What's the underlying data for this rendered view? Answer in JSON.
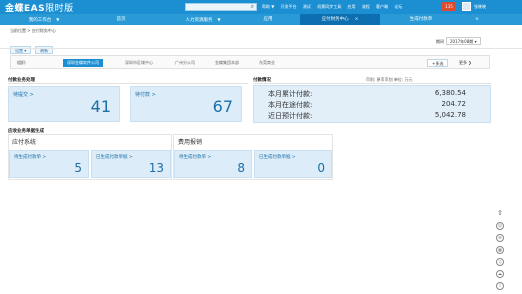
{
  "header": {
    "brand": "金蝶EAS",
    "brand_suffix": "限时版",
    "search_placeholder": "",
    "links": [
      "帮助 ▼",
      "开发平台",
      "测试",
      "机票同步工具",
      "应用",
      "流程",
      "客户端",
      "论坛"
    ],
    "badge": "135",
    "user": "张晓晓"
  },
  "nav": [
    {
      "label": "我的工作台",
      "dropdown": true
    },
    {
      "label": "首页",
      "dropdown": false
    },
    {
      "label": "人力资源服务",
      "dropdown": true
    },
    {
      "label": "应用",
      "dropdown": false
    },
    {
      "label": "应付财务中心",
      "dropdown": false,
      "active": true,
      "close": "×"
    },
    {
      "label": "生成付款单",
      "dropdown": false,
      "close": "×"
    }
  ],
  "breadcrumb": "当前位置 > 应付财务中心",
  "buttons": {
    "settings": "设置",
    "refresh": "刷新"
  },
  "period": {
    "label": "期间",
    "value": "2017年08期"
  },
  "org": {
    "label": "组织:",
    "tabs": [
      "深圳金蝶软件公司",
      "深圳市区域中心",
      "广州分公司",
      "金蝶集团本部",
      "东莞商业"
    ],
    "multi": "+多选",
    "more": "更多 ❯"
  },
  "sections": {
    "payment_business": "付款业务处理",
    "fund_status": "付款情况",
    "fund_meta": "币别:  原币币别     单位:  万元",
    "payable_gen": "应收业务单据生成"
  },
  "kpis": [
    {
      "label": "待提交 >",
      "value": "41"
    },
    {
      "label": "待付款 >",
      "value": "67"
    }
  ],
  "fund_rows": [
    {
      "label": "本月累计付款:",
      "value": "6,380.54"
    },
    {
      "label": "本月在途付款:",
      "value": "204.72"
    },
    {
      "label": "近日预计付款:",
      "value": "5,042.78"
    }
  ],
  "groups": [
    {
      "title": "应付系统",
      "cards": [
        {
          "label": "待生成付款单 >",
          "value": "5"
        },
        {
          "label": "已生成付款单据 >",
          "value": "13"
        }
      ]
    },
    {
      "title": "费用报销",
      "cards": [
        {
          "label": "待生成付款单 >",
          "value": "8"
        },
        {
          "label": "已生成付款单据 >",
          "value": "0"
        }
      ]
    }
  ],
  "right_icons": [
    "arrow-up-icon",
    "person-icon",
    "message-icon",
    "calendar-icon",
    "headset-icon",
    "chat-icon",
    "info-icon"
  ]
}
